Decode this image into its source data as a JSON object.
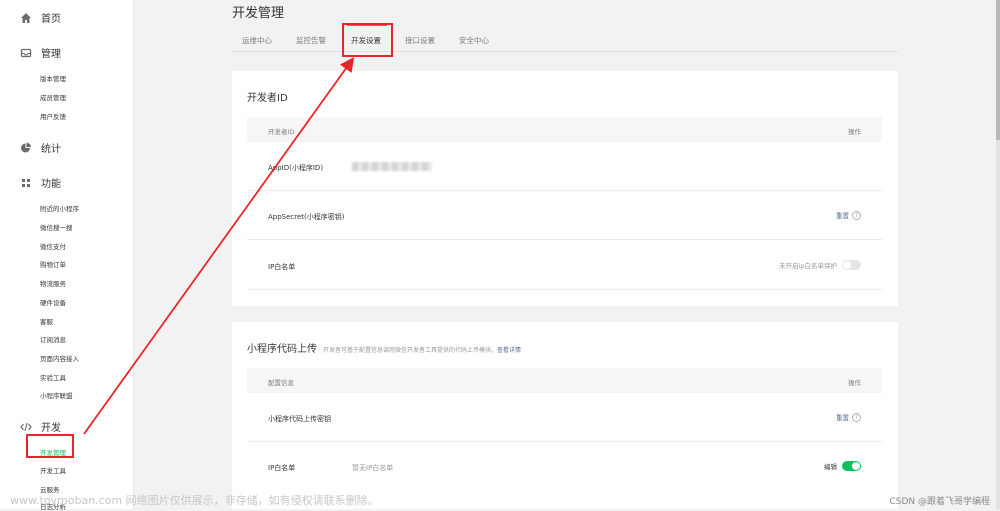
{
  "sidebar": {
    "home": "首页",
    "manage": {
      "label": "管理",
      "items": [
        "版本管理",
        "成员管理",
        "用户反馈"
      ]
    },
    "stats": "统计",
    "features": {
      "label": "功能",
      "items": [
        "附近的小程序",
        "微信搜一搜",
        "微信支付",
        "购物订单",
        "物流服务",
        "硬件设备",
        "客服",
        "订阅消息",
        "页面内容接入",
        "实验工具",
        "小程序联盟"
      ]
    },
    "dev": {
      "label": "开发",
      "items": [
        "开发管理",
        "开发工具",
        "云服务",
        "日志分析"
      ]
    }
  },
  "page": {
    "title": "开发管理"
  },
  "tabs": [
    "运维中心",
    "监控告警",
    "开发设置",
    "接口设置",
    "安全中心"
  ],
  "developer_id": {
    "title": "开发者ID",
    "header_left": "开发者ID",
    "header_right": "操作",
    "rows": [
      {
        "label": "AppID(小程序ID)",
        "value": "",
        "action": ""
      },
      {
        "label": "AppSecret(小程序密钥)",
        "value": "",
        "action": "重置"
      },
      {
        "label": "IP白名单",
        "value": "",
        "action": "未开启ip白名单保护"
      }
    ]
  },
  "code_upload": {
    "title": "小程序代码上传",
    "desc": "开发者可基于配置信息调用微信开发者工具提供的代码上传模块。",
    "link": "查看详情",
    "header_left": "配置信息",
    "header_right": "操作",
    "rows": [
      {
        "label": "小程序代码上传密钥",
        "value": "",
        "action": "重置"
      },
      {
        "label": "IP白名单",
        "value": "暂无IP白名单",
        "action": "编辑"
      }
    ]
  },
  "watermark": {
    "left": "www.toymoban.com 网络图片仅供展示，非存储，如有侵权请联系删除。",
    "right": "CSDN @跟着飞哥学编程"
  },
  "colors": {
    "accent": "#07c160",
    "link": "#576b95",
    "annotation": "#e8262a"
  }
}
